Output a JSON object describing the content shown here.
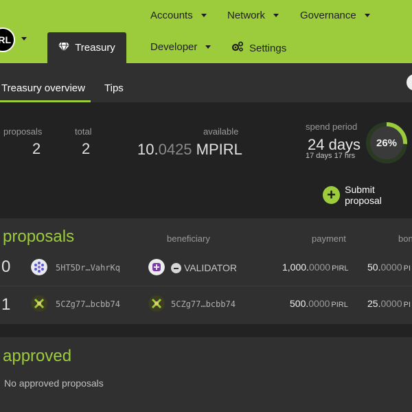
{
  "brand": {
    "logo_text": "RL"
  },
  "topnav": {
    "active_tab": "Treasury",
    "items": [
      {
        "label": "Accounts"
      },
      {
        "label": "Network"
      },
      {
        "label": "Governance"
      },
      {
        "label": "Developer"
      },
      {
        "label": "Settings"
      }
    ]
  },
  "subnav": {
    "tabs": [
      {
        "label": "Treasury overview",
        "active": true
      },
      {
        "label": "Tips",
        "active": false
      }
    ]
  },
  "summary": {
    "proposals_label": "proposals",
    "proposals_value": "2",
    "total_label": "total",
    "total_value": "2",
    "available_label": "available",
    "available_int": "10.",
    "available_frac": "0425",
    "available_unit": " MPIRL",
    "spend_period_label": "spend period",
    "spend_period_value": "24 days",
    "spend_period_remaining": "17 days 17 hrs",
    "spend_period_percent": "26%",
    "spend_period_fraction": 0.26,
    "submit_label": "Submit proposal",
    "accent_color": "#9ccc3c"
  },
  "proposals": {
    "title": "proposals",
    "columns": {
      "beneficiary": "beneficiary",
      "payment": "payment",
      "bond": "bon"
    },
    "rows": [
      {
        "index": "0",
        "proposer": "5HT5Dr…VahrKq",
        "beneficiary_name": "VALIDATOR",
        "payment_int": "1,000.",
        "payment_frac": "0000",
        "payment_unit": "PIRL",
        "bond_int": "50.",
        "bond_frac": "0000",
        "bond_unit": "PI"
      },
      {
        "index": "1",
        "proposer": "5CZg77…bcbb74",
        "beneficiary_addr": "5CZg77…bcbb74",
        "payment_int": "500.",
        "payment_frac": "0000",
        "payment_unit": "PIRL",
        "bond_int": "25.",
        "bond_frac": "0000",
        "bond_unit": "PI"
      }
    ]
  },
  "approved": {
    "title": "approved",
    "empty_text": "No approved proposals"
  }
}
